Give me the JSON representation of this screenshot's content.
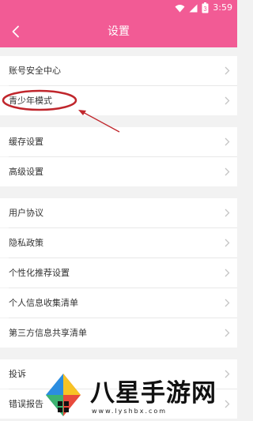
{
  "status_bar": {
    "time": "3:59",
    "icons": [
      "wifi-icon",
      "signal-icon",
      "battery-icon"
    ],
    "battery_level": "3"
  },
  "header": {
    "title": "设置"
  },
  "sections": [
    {
      "items": [
        {
          "label": "账号安全中心"
        },
        {
          "label": "青少年模式"
        }
      ]
    },
    {
      "items": [
        {
          "label": "缓存设置"
        },
        {
          "label": "高级设置"
        }
      ]
    },
    {
      "items": [
        {
          "label": "用户协议"
        },
        {
          "label": "隐私政策"
        },
        {
          "label": "个性化推荐设置"
        },
        {
          "label": "个人信息收集清单"
        },
        {
          "label": "第三方信息共享清单"
        }
      ]
    },
    {
      "items": [
        {
          "label": "投诉"
        },
        {
          "label": "错误报告"
        }
      ]
    }
  ],
  "watermark": {
    "text": "八星手游网",
    "url": "www.lyshbx.com"
  },
  "colors": {
    "brand_pink": "#f25b95",
    "annotation_red": "#c0262c",
    "page_background": "#f2f2f2"
  }
}
